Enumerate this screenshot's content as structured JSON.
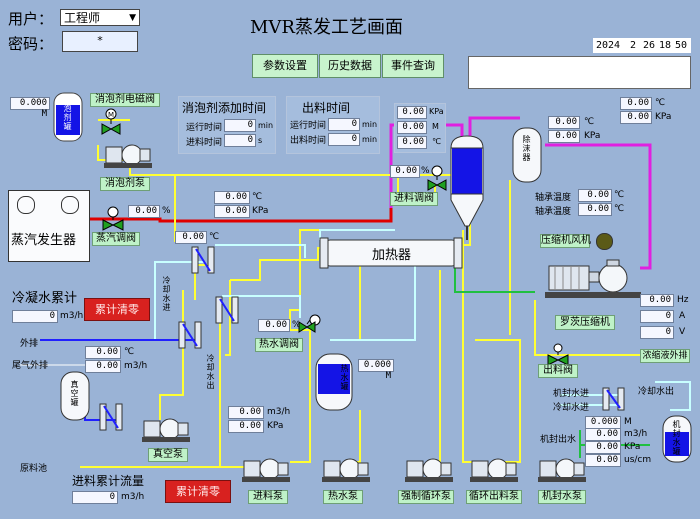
{
  "login": {
    "user_label": "用户：",
    "user_value": "工程师",
    "password_label": "密码：",
    "password_value": "*"
  },
  "title": "MVR蒸发工艺画面",
  "nav_buttons": [
    "参数设置",
    "历史数据",
    "事件查询"
  ],
  "datetime": {
    "year": "2024",
    "month": "2",
    "day": "26",
    "hour": "18",
    "minute": "50"
  },
  "defoamer": {
    "tank_level": "0.000 M",
    "valve_label": "消泡剂电磁阀",
    "pump_label": "消泡剂泵",
    "tank_label": "消泡剂罐",
    "add_time_title": "消泡剂添加时间",
    "run_time_label": "运行时间",
    "run_time_value": "0",
    "run_time_unit": "min",
    "feed_time_label": "进料时间",
    "feed_time_value": "0",
    "feed_time_unit": "s"
  },
  "discharge_time": {
    "title": "出料时间",
    "run_time_label": "运行时间",
    "run_time_value": "0",
    "run_time_unit": "min",
    "discharge_label": "出料时间",
    "discharge_value": "0",
    "discharge_unit": "min"
  },
  "evaporator": {
    "pressure": "0.00",
    "pressure_unit": "KPa",
    "level": "0.00",
    "level_unit": "M",
    "temp": "0.00",
    "temp_unit": "℃"
  },
  "separator": {
    "label": "除沫器",
    "temp": "0.00",
    "temp_unit": "℃",
    "pressure": "0.00",
    "pressure_unit": "KPa"
  },
  "top": {
    "temp": "0.00",
    "temp_unit": "℃",
    "pressure": "0.00",
    "pressure_unit": "KPa"
  },
  "feed_valve": {
    "label": "进料调阀",
    "value": "0.00",
    "unit": "%"
  },
  "steam": {
    "generator_label": "蒸汽发生器",
    "valve_label": "蒸汽调阀",
    "valve_value": "0.00",
    "valve_unit": "%",
    "temp": "0.00",
    "temp_unit": "℃",
    "pressure": "0.00",
    "pressure_unit": "KPa"
  },
  "heater": {
    "label": "加热器"
  },
  "compressor": {
    "bearing_temp1_label": "轴承温度",
    "bearing_temp1": "0.00",
    "bearing_temp2_label": "轴承温度",
    "bearing_temp2": "0.00",
    "temp_unit": "℃",
    "fan_label": "压缩机风机",
    "label": "罗茨压缩机",
    "freq": "0.00",
    "freq_unit": "Hz",
    "current": "0",
    "current_unit": "A",
    "voltage": "0",
    "voltage_unit": "V"
  },
  "condensate": {
    "title": "冷凝水累计",
    "flow": "0",
    "flow_unit": "m3/h",
    "clear_label": "累计清零",
    "hx_temp": "0.00",
    "hx_temp_unit": "℃",
    "cooling_in": "冷却水进",
    "cooling_out": "冷却水出"
  },
  "hot_water": {
    "valve_label": "热水调阀",
    "valve_value": "0.00",
    "valve_unit": "%",
    "tank_label": "热水罐",
    "tank_level": "0.000 M",
    "pump_label": "热水泵"
  },
  "vacuum": {
    "tank_label": "真空罐",
    "outlet_label": "外排",
    "tail_gas_label": "尾气外排",
    "temp": "0.00",
    "temp_unit": "℃",
    "flow": "0.00",
    "flow_unit": "m3/h",
    "pump_label": "真空泵"
  },
  "feed_pump": {
    "label": "进料泵",
    "flow": "0.00",
    "flow_unit": "m3/h",
    "pressure": "0.00",
    "pressure_unit": "KPa"
  },
  "raw_tank_label": "原料池",
  "feed_total": {
    "title": "进料累计流量",
    "value": "0",
    "unit": "m3/h",
    "clear_label": "累计清零"
  },
  "pumps": {
    "circulation": "强制循环泵",
    "circ_discharge": "循环出料泵",
    "seal_water": "机封水泵"
  },
  "discharge": {
    "valve_label": "出料阀",
    "concentrate_label": "浓缩液外排"
  },
  "seal_water": {
    "in_label": "机封水进",
    "cooling_in": "冷却水进",
    "cooling_out": "冷却水出",
    "seal_out": "机封出水",
    "level": "0.000",
    "level_unit": "M",
    "flow": "0.00",
    "flow_unit": "m3/h",
    "pressure": "0.00",
    "pressure_unit": "KPa",
    "speed": "0.00",
    "speed_unit": "us/cm",
    "tank_label": "机封水罐"
  },
  "colors": {
    "background": "#9ab3d6",
    "yellow_pipe": "#ffff33",
    "cyan_pipe": "#c8ffff",
    "magenta_pipe": "#e020e0",
    "red_pipe": "#e00000",
    "blue_pipe": "#2020ff",
    "green_pipe": "#20c040",
    "vessel_blue": "#1414e6"
  }
}
